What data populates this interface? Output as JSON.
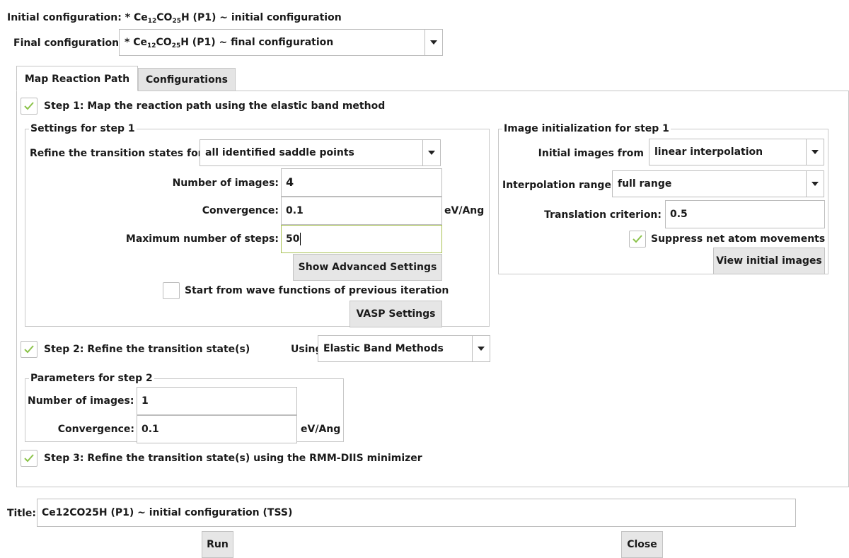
{
  "header": {
    "initial_label": "Initial configuration:",
    "initial_value": {
      "prefix": "* Ce",
      "sub1": "12",
      "mid": "CO",
      "sub2": "25",
      "suffix": "H  (P1) ~ initial configuration"
    },
    "final_label": "Final configuration:",
    "final_value": {
      "prefix": "* Ce",
      "sub1": "12",
      "mid": "CO",
      "sub2": "25",
      "suffix": "H  (P1) ~ final configuration"
    }
  },
  "tabs": [
    {
      "label": "Map Reaction Path",
      "active": true
    },
    {
      "label": "Configurations",
      "active": false
    }
  ],
  "step1": {
    "checkbox_label": "Step 1: Map the reaction path using the elastic band method",
    "checked": true,
    "settings": {
      "group_title": "Settings for step 1",
      "refine_label": "Refine the transition states for",
      "refine_value": "all identified saddle points",
      "num_images_label": "Number of images:",
      "num_images_value": "4",
      "convergence_label": "Convergence:",
      "convergence_value": "0.1",
      "convergence_unit": "eV/Ang",
      "max_steps_label": "Maximum number of steps:",
      "max_steps_value": "50",
      "advanced_button": "Show Advanced Settings",
      "wavefn_label": "Start from wave functions of previous iteration",
      "wavefn_checked": false,
      "vasp_button": "VASP Settings"
    },
    "image_init": {
      "group_title": "Image initialization for step 1",
      "initial_images_label": "Initial images from",
      "initial_images_value": "linear interpolation",
      "interp_range_label": "Interpolation range",
      "interp_range_value": "full range",
      "translation_label": "Translation criterion:",
      "translation_value": "0.5",
      "suppress_label": "Suppress net atom movements",
      "suppress_checked": true,
      "view_button": "View initial images"
    }
  },
  "step2": {
    "checkbox_label": "Step 2: Refine the transition state(s)",
    "checked": true,
    "using_label": "Using",
    "using_value": "Elastic Band Methods",
    "params": {
      "group_title": "Parameters for step 2",
      "num_images_label": "Number of images:",
      "num_images_value": "1",
      "convergence_label": "Convergence:",
      "convergence_value": "0.1",
      "convergence_unit": "eV/Ang"
    }
  },
  "step3": {
    "checkbox_label": "Step 3: Refine the transition state(s) using the RMM-DIIS minimizer",
    "checked": true
  },
  "footer": {
    "title_label": "Title:",
    "title_value": "Ce12CO25H  (P1) ~ initial configuration (TSS)",
    "run_button": "Run",
    "close_button": "Close"
  },
  "colors": {
    "check_mark": "#8bc34a",
    "focus_border": "#a9c255",
    "button_bg": "#e6e6e6"
  }
}
